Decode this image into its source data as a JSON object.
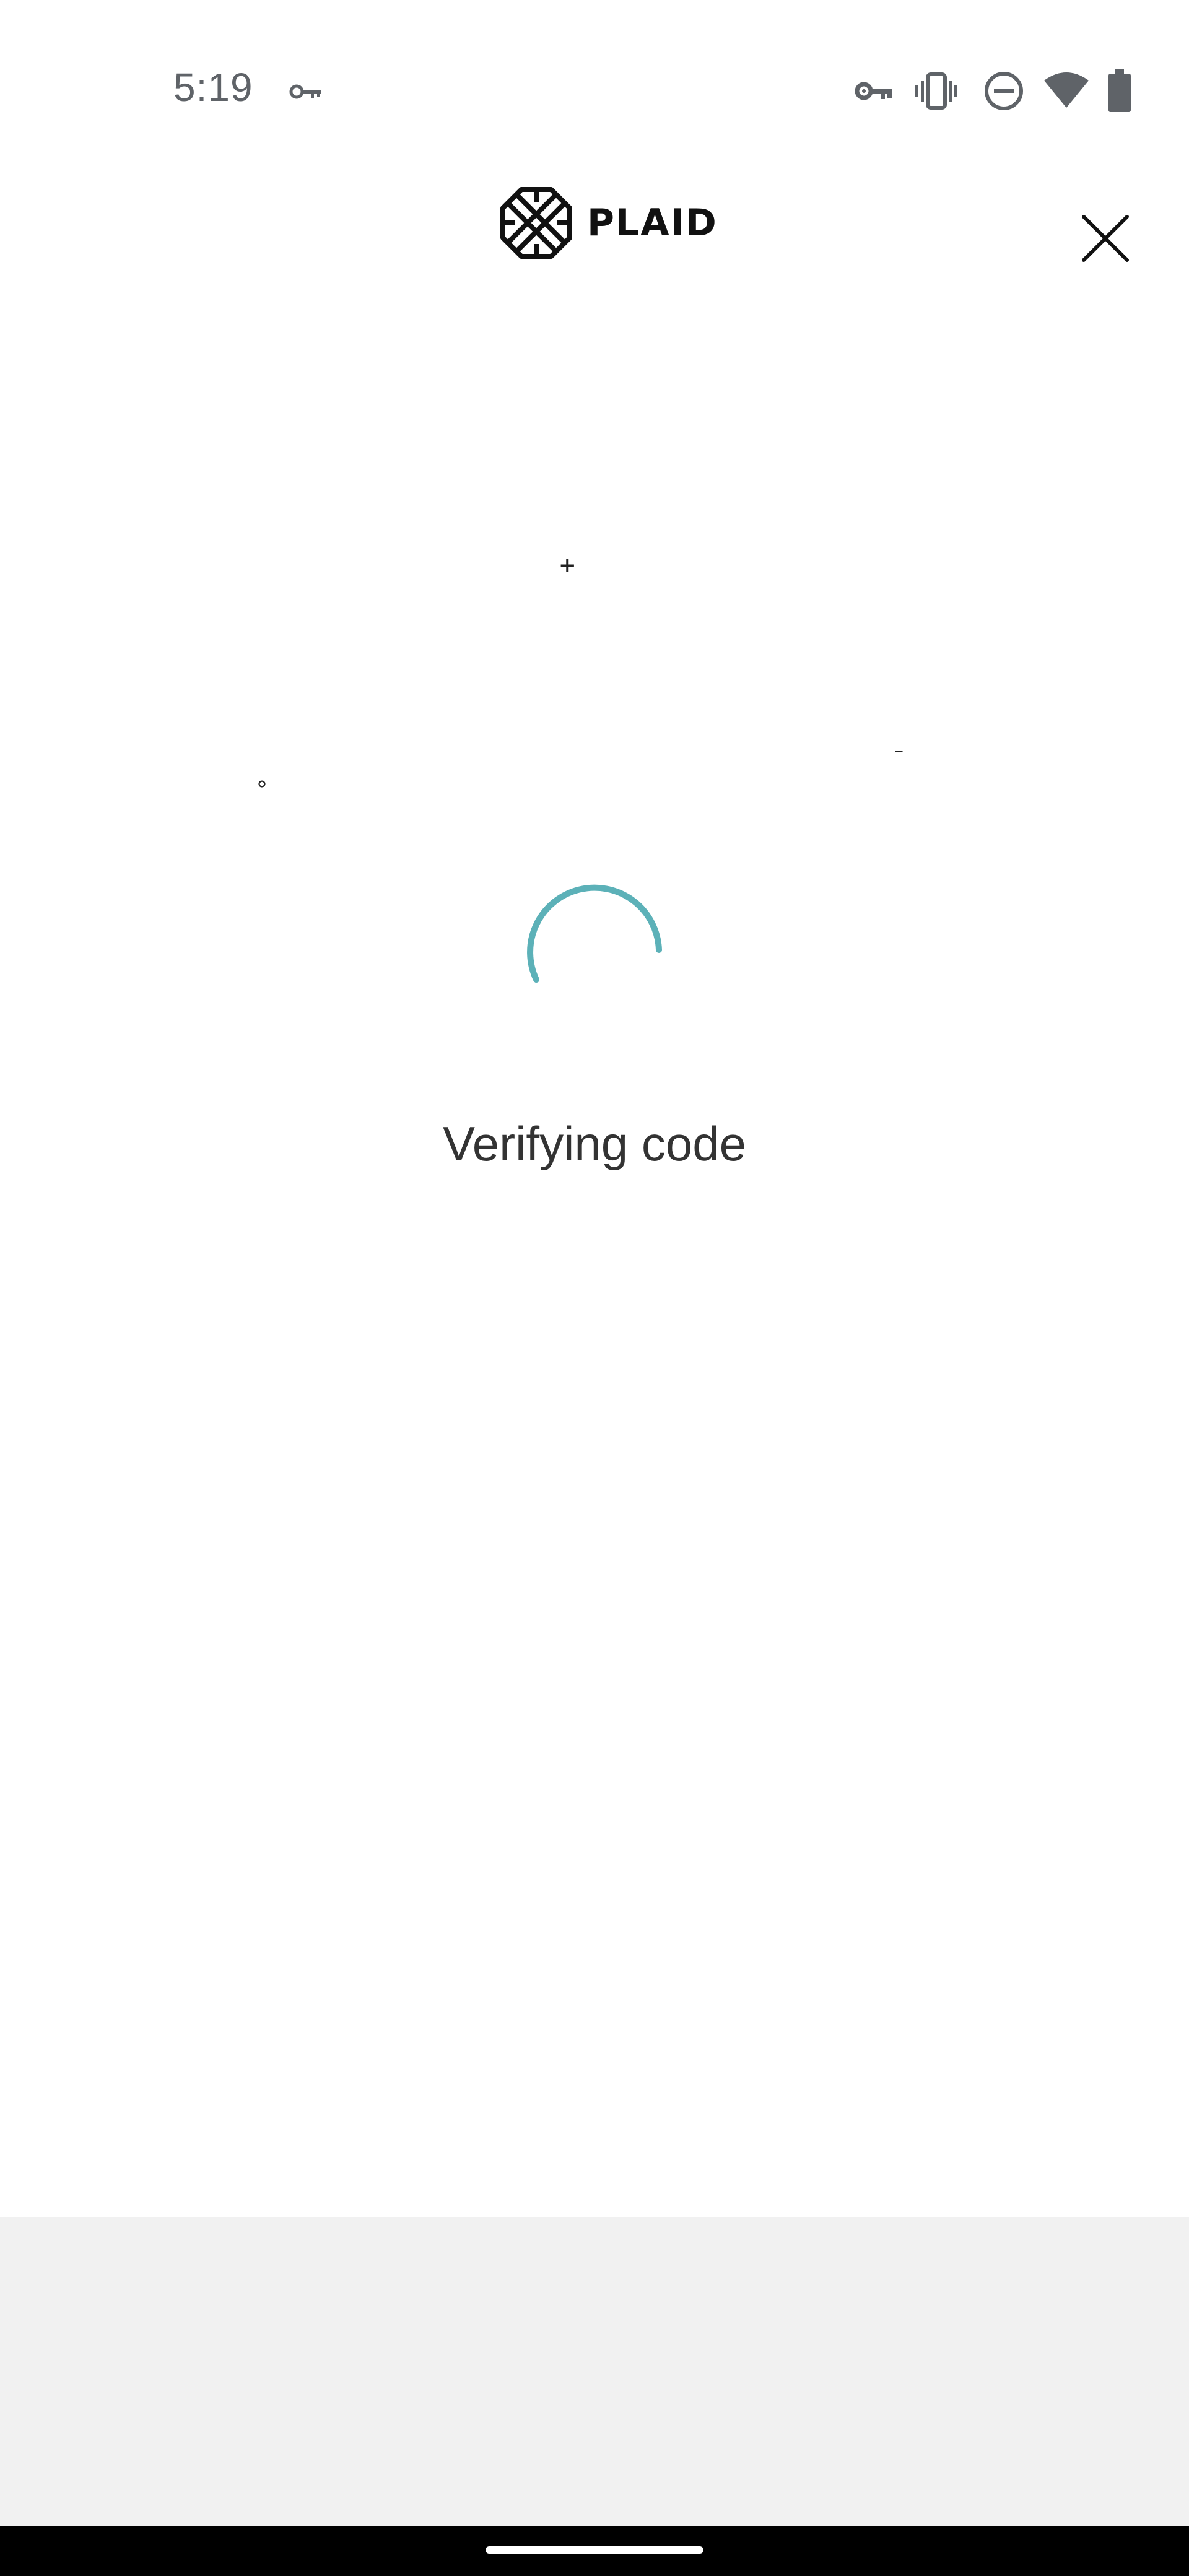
{
  "status_bar": {
    "time": "5:19",
    "icons": [
      "vpn-key-icon",
      "vpn-key-icon",
      "vibrate-icon",
      "do-not-disturb-icon",
      "wifi-icon",
      "battery-icon"
    ]
  },
  "header": {
    "logo_text": "PLAID",
    "close_icon": "close-icon"
  },
  "artifacts": {
    "plus": "+",
    "dash": "–",
    "degree": "°"
  },
  "main": {
    "spinner_icon": "loading-spinner-icon",
    "status_message": "Verifying code"
  },
  "colors": {
    "accent": "#5cb1b8",
    "text": "#333333",
    "status_icons": "#5f6368",
    "bottom_panel": "#f1f1f1",
    "nav_bar": "#000000"
  }
}
